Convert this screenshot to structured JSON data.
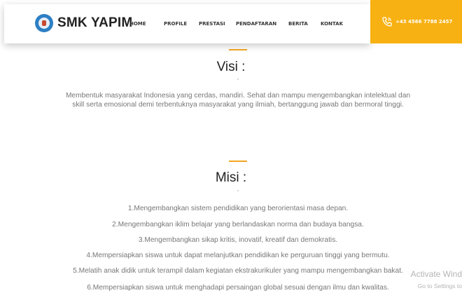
{
  "brand": {
    "name": "SMK YAPIM"
  },
  "nav": {
    "items": [
      {
        "label": "HOME"
      },
      {
        "label": "PROFILE"
      },
      {
        "label": "PRESTASI"
      },
      {
        "label": "PENDAFTARAN"
      },
      {
        "label": "BERITA"
      },
      {
        "label": "KONTAK"
      }
    ]
  },
  "contact": {
    "phone": "+43 4566 7788 2457",
    "icon": "phone-icon"
  },
  "visi": {
    "title": "Visi :",
    "lines": [
      "Membentuk masyarakat Indonesia yang cerdas, mandiri. Sehat dan mampu mengembangkan intelektual dan",
      "skill serta emosional demi terbentuknya masyarakat yang ilmiah, bertanggung jawab dan bermoral tinggi."
    ]
  },
  "misi": {
    "title": "Misi :",
    "items": [
      "1.Mengembangkan sistem pendidikan yang berorientasi masa depan.",
      "2.Mengembangkan iklim belajar yang berlandaskan norma dan budaya bangsa.",
      "3.Mengembangkan sikap kritis, inovatif, kreatif dan demokratis.",
      "4.Mempersiapkan siswa untuk dapat melanjutkan pendidikan ke perguruan tinggi yang bermutu.",
      "5.Melatih anak didik untuk terampil dalam kegiatan ekstrakurikuler yang mampu mengembangkan bakat.",
      "6.Mempersiapkan siswa untuk menghadapi persaingan global sesuai dengan ilmu dan kwalitas."
    ]
  },
  "watermark": {
    "line1": "Activate Wind",
    "line2": "Go to Settings to"
  },
  "colors": {
    "accent": "#f5a623",
    "phone_bg": "#f8b112",
    "text": "#777777",
    "heading": "#222222"
  }
}
